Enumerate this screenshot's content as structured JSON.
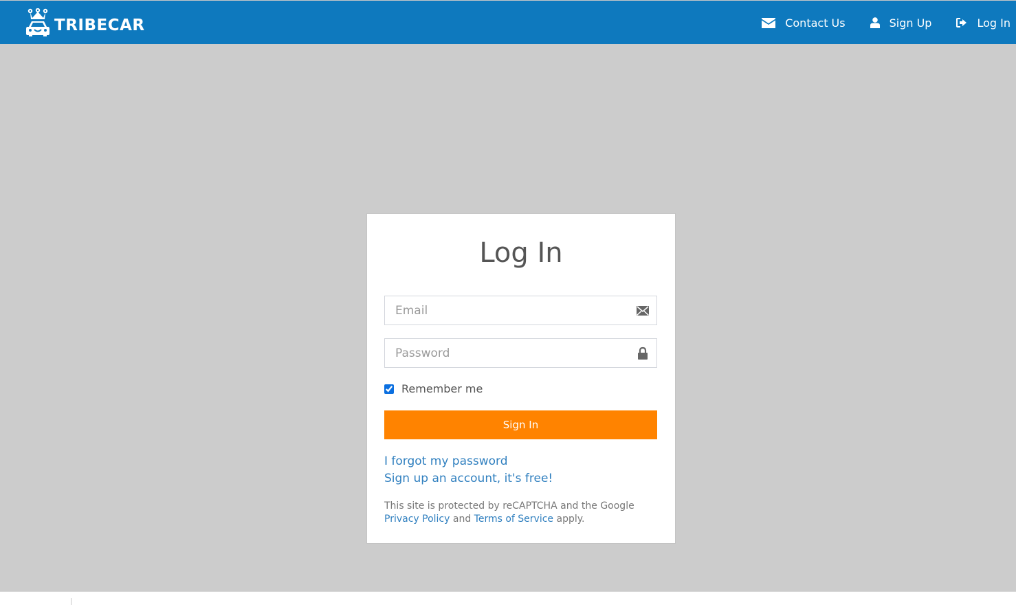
{
  "header": {
    "brand_name": "TRIBECAR",
    "brand_logo_icon": "crowned-car-logo",
    "background_color": "#0e79be",
    "nav": [
      {
        "label": "Contact Us",
        "icon": "envelope-icon"
      },
      {
        "label": "Sign Up",
        "icon": "user-icon"
      },
      {
        "label": "Log In",
        "icon": "sign-in-icon"
      }
    ]
  },
  "login": {
    "title": "Log In",
    "email": {
      "placeholder": "Email",
      "value": "",
      "icon": "envelope-icon"
    },
    "password": {
      "placeholder": "Password",
      "value": "",
      "icon": "lock-icon"
    },
    "remember_me": {
      "label": "Remember me",
      "checked": true
    },
    "submit_label": "Sign In",
    "submit_color": "#ff8300",
    "forgot_link": "I forgot my password",
    "signup_link": "Sign up an account, it's free!",
    "legal": {
      "prefix": "This site is protected by reCAPTCHA and the Google",
      "privacy_link": "Privacy Policy",
      "and": "and",
      "terms_link": "Terms of Service",
      "suffix": "apply."
    }
  },
  "colors": {
    "page_background": "#cccccc",
    "link": "#2f7fbf",
    "title_text": "#555555"
  }
}
